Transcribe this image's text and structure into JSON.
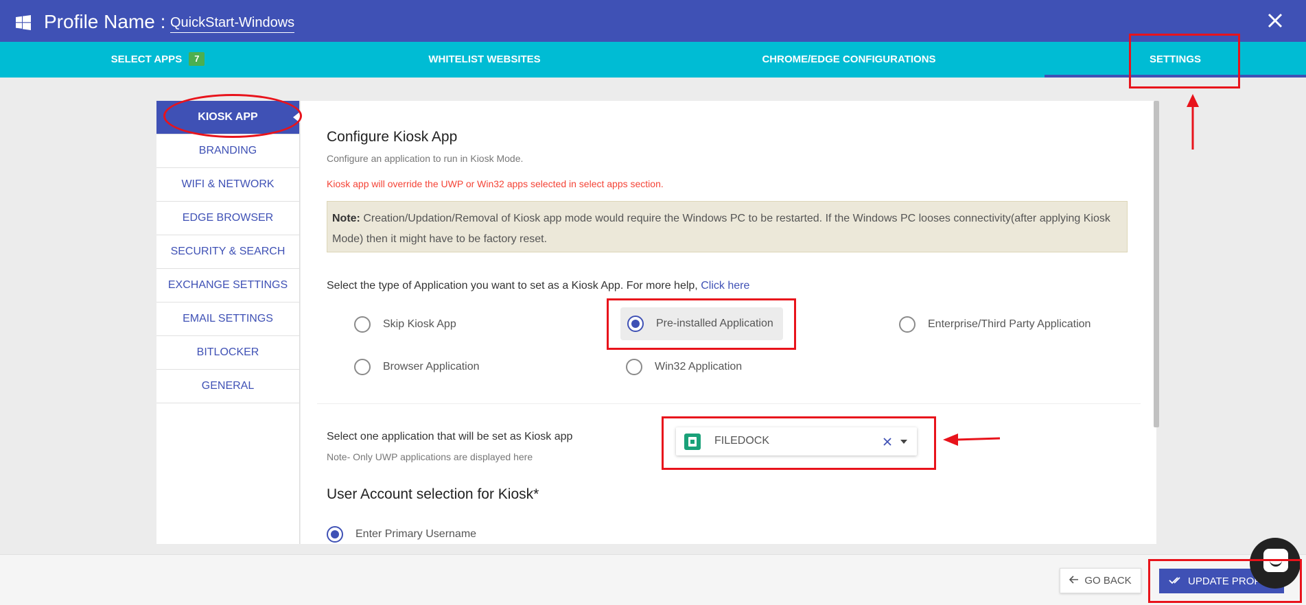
{
  "header": {
    "logo_icon": "windows-logo-icon",
    "profile_label": "Profile Name :",
    "profile_name": "QuickStart-Windows",
    "close_icon": "close-icon"
  },
  "tabs": [
    {
      "label": "SELECT APPS",
      "count": "7"
    },
    {
      "label": "WHITELIST WEBSITES"
    },
    {
      "label": "CHROME/EDGE CONFIGURATIONS"
    },
    {
      "label": "SETTINGS",
      "active": true
    }
  ],
  "sidebar": {
    "items": [
      {
        "label": "KIOSK APP",
        "active": true
      },
      {
        "label": "BRANDING"
      },
      {
        "label": "WIFI & NETWORK"
      },
      {
        "label": "EDGE BROWSER"
      },
      {
        "label": "SECURITY & SEARCH"
      },
      {
        "label": "EXCHANGE SETTINGS"
      },
      {
        "label": "EMAIL SETTINGS"
      },
      {
        "label": "BITLOCKER"
      },
      {
        "label": "GENERAL"
      }
    ]
  },
  "kiosk": {
    "title": "Configure Kiosk App",
    "subtitle": "Configure an application to run in Kiosk Mode.",
    "warning": "Kiosk app will override the UWP or Win32 apps selected in select apps section.",
    "note_label": "Note:",
    "note_text": " Creation/Updation/Removal of Kiosk app mode would require the Windows PC to be restarted. If the Windows PC looses connectivity(after applying Kiosk Mode) then it might have to be factory reset.",
    "question": "Select the type of Application you want to set as a Kiosk App. For more help, ",
    "help_link": "Click here",
    "app_types": [
      {
        "label": "Skip Kiosk App",
        "checked": false
      },
      {
        "label": "Pre-installed Application",
        "checked": true
      },
      {
        "label": "Enterprise/Third Party Application",
        "checked": false
      },
      {
        "label": "Browser Application",
        "checked": false
      },
      {
        "label": "Win32 Application",
        "checked": false
      }
    ],
    "select_label": "Select one application that will be set as Kiosk app",
    "select_note": "Note- Only UWP applications are displayed here",
    "selected_app": "FILEDOCK",
    "user_title": "User Account selection for Kiosk*",
    "user_option": "Enter Primary Username"
  },
  "footer": {
    "back_label": "GO BACK",
    "update_label": "UPDATE PROFILE"
  },
  "colors": {
    "primary": "#3f51b5",
    "tab_bar": "#00bcd4",
    "warning": "#f44336",
    "annotation": "#e8131b",
    "count_badge": "#4caf50"
  }
}
